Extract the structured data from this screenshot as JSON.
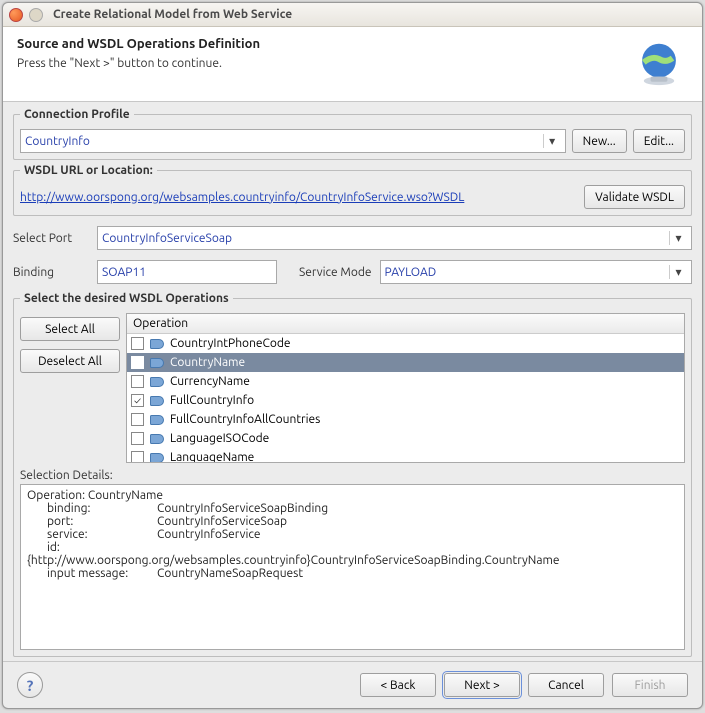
{
  "window": {
    "title": "Create Relational Model from Web Service"
  },
  "header": {
    "heading": "Source and WSDL Operations Definition",
    "subheading": "Press the \"Next >\" button to continue."
  },
  "connectionProfile": {
    "legend": "Connection Profile",
    "value": "CountryInfo",
    "new_btn": "New...",
    "edit_btn": "Edit..."
  },
  "wsdl": {
    "legend": "WSDL URL or Location:",
    "url": "http://www.oorspong.org/websamples.countryinfo/CountryInfoService.wso?WSDL",
    "validate_btn": "Validate WSDL"
  },
  "port": {
    "label": "Select Port",
    "value": "CountryInfoServiceSoap"
  },
  "binding": {
    "label": "Binding",
    "value": "SOAP11"
  },
  "mode": {
    "label": "Service Mode",
    "value": "PAYLOAD"
  },
  "ops": {
    "legend": "Select the desired WSDL Operations",
    "select_all": "Select All",
    "deselect_all": "Deselect All",
    "col_header": "Operation",
    "items": [
      {
        "label": "CountryIntPhoneCode",
        "checked": false,
        "selected": false
      },
      {
        "label": "CountryName",
        "checked": true,
        "selected": true
      },
      {
        "label": "CurrencyName",
        "checked": false,
        "selected": false
      },
      {
        "label": "FullCountryInfo",
        "checked": true,
        "selected": false
      },
      {
        "label": "FullCountryInfoAllCountries",
        "checked": false,
        "selected": false
      },
      {
        "label": "LanguageISOCode",
        "checked": false,
        "selected": false
      },
      {
        "label": "LanguageName",
        "checked": false,
        "selected": false
      }
    ]
  },
  "details": {
    "label": "Selection Details:",
    "op_line": "Operation: CountryName",
    "k_binding": "binding:",
    "v_binding": "CountryInfoServiceSoapBinding",
    "k_port": "port:",
    "v_port": "CountryInfoServiceSoap",
    "k_service": "service:",
    "v_service": "CountryInfoService",
    "k_id": "id:",
    "v_id": "{http://www.oorspong.org/websamples.countryinfo}CountryInfoServiceSoapBinding.CountryName",
    "k_imsg": "input message:",
    "v_imsg": "CountryNameSoapRequest"
  },
  "footer": {
    "back": "< Back",
    "next": "Next >",
    "cancel": "Cancel",
    "finish": "Finish"
  }
}
